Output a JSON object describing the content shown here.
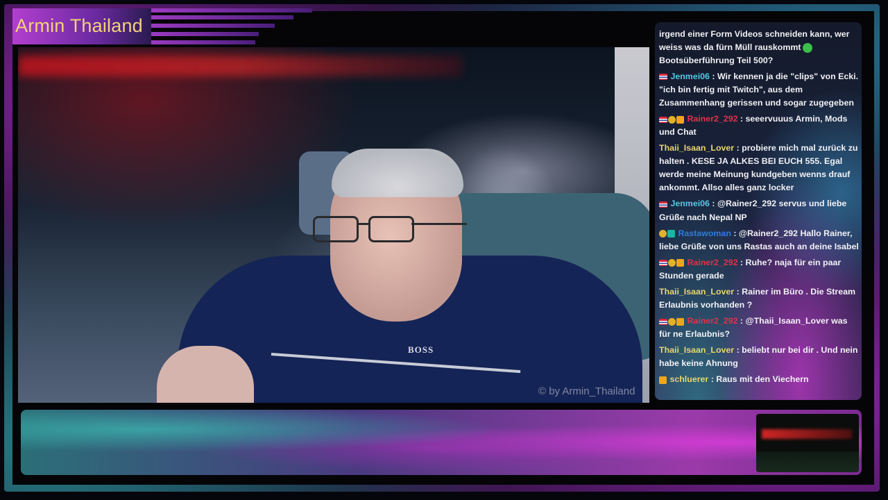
{
  "stream": {
    "title": "Armin Thailand",
    "watermark": "© by Armin_Thailand"
  },
  "video": {
    "shirt_brand": "BOSS"
  },
  "chat": {
    "messages": [
      {
        "user": "",
        "color": "#f1f1f4",
        "badges": [],
        "text": "irgend einer Form Videos schneiden kann, wer weiss was da fürn Müll rauskommt",
        "emote": "green-emote",
        "continuation": "Bootsüberführung Teil 500?"
      },
      {
        "user": "Jenmei06",
        "color": "#57c7e3",
        "badges": [
          "flag"
        ],
        "text": "Wir kennen ja die \"clips\" von Ecki. \"ich bin fertig mit Twitch\", aus dem Zusammenhang gerissen und sogar zugegeben"
      },
      {
        "user": "Rainer2_292",
        "color": "#e0324a",
        "badges": [
          "flag",
          "gold",
          "crown"
        ],
        "text": "seeervuuus Armin, Mods und Chat"
      },
      {
        "user": "Thaii_Isaan_Lover",
        "color": "#e8d56a",
        "badges": [],
        "text": "probiere mich mal zurück zu halten . KESE JA ALKES BEI EUCH 555. Egal werde meine Meinung kundgeben wenns drauf ankommt. Allso alles ganz locker"
      },
      {
        "user": "Jenmei06",
        "color": "#57c7e3",
        "badges": [
          "flag"
        ],
        "text": "@Rainer2_292 servus und liebe Grüße nach Nepal NP"
      },
      {
        "user": "Rastawoman",
        "color": "#2f7be0",
        "badges": [
          "gold",
          "teal"
        ],
        "text": "@Rainer2_292 Hallo Rainer, liebe Grüße von uns Rastas auch an deine Isabel"
      },
      {
        "user": "Rainer2_292",
        "color": "#e0324a",
        "badges": [
          "flag",
          "gold",
          "crown"
        ],
        "text": "Ruhe? naja für ein paar Stunden gerade"
      },
      {
        "user": "Thaii_Isaan_Lover",
        "color": "#e8d56a",
        "badges": [],
        "text": "Rainer im Büro . Die Stream Erlaubnis vorhanden ?"
      },
      {
        "user": "Rainer2_292",
        "color": "#e0324a",
        "badges": [
          "flag",
          "gold",
          "crown"
        ],
        "text": "@Thaii_Isaan_Lover was für ne Erlaubnis?"
      },
      {
        "user": "Thaii_Isaan_Lover",
        "color": "#e8d56a",
        "badges": [],
        "text": "beliebt nur bei dir . Und nein habe keine Ahnung"
      },
      {
        "user": "schluerer",
        "color": "#e8d56a",
        "badges": [
          "crown"
        ],
        "text": "Raus mit den Viechern"
      }
    ]
  }
}
